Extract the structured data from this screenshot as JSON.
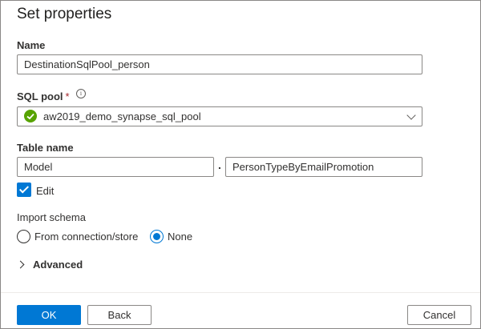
{
  "dialog": {
    "title": "Set properties"
  },
  "name": {
    "label": "Name",
    "value": "DestinationSqlPool_person"
  },
  "sql_pool": {
    "label": "SQL pool",
    "required_mark": "*",
    "info_icon": "info-icon",
    "status_icon": "check-circle-icon",
    "value": "aw2019_demo_synapse_sql_pool"
  },
  "table_name": {
    "label": "Table name",
    "schema_value": "Model",
    "separator": ".",
    "table_value": "PersonTypeByEmailPromotion",
    "edit_label": "Edit",
    "edit_checked": true
  },
  "import_schema": {
    "label": "Import schema",
    "options": [
      "From connection/store",
      "None"
    ],
    "selected": "None"
  },
  "advanced": {
    "label": "Advanced",
    "expanded": false
  },
  "footer": {
    "ok_label": "OK",
    "back_label": "Back",
    "cancel_label": "Cancel"
  },
  "colors": {
    "accent": "#0078d4",
    "success": "#57a300",
    "required": "#a4262c"
  }
}
